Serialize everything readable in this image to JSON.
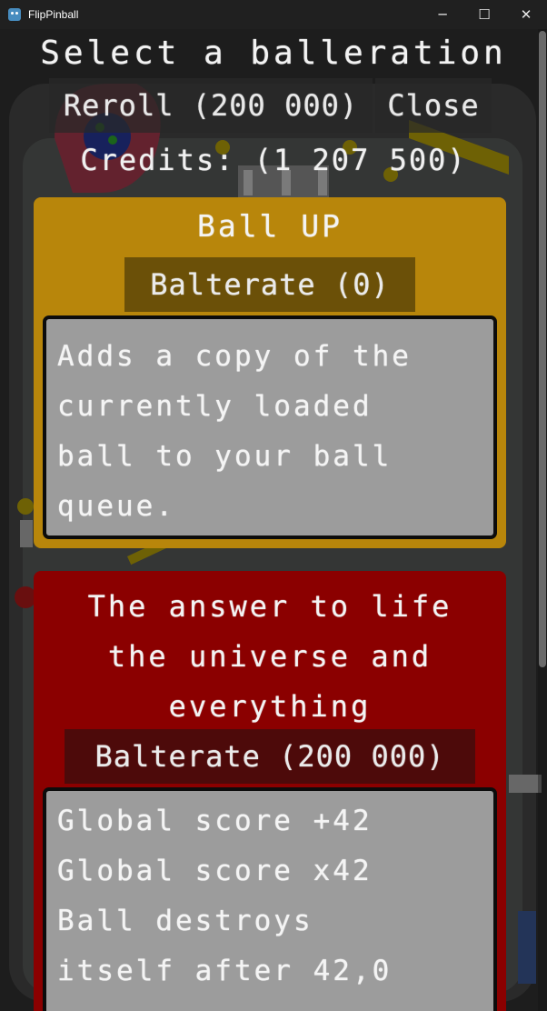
{
  "window": {
    "title": "FlipPinball",
    "controls": {
      "minimize": "─",
      "maximize": "☐",
      "close": "✕"
    }
  },
  "header": {
    "title": "Select a balleration",
    "reroll_label": "Reroll (200 000)",
    "close_label": "Close",
    "credits_label": "Credits: (1 207 500)"
  },
  "cards": [
    {
      "title": "Ball UP",
      "button_label": "Balterate (0)",
      "description": "Adds a copy of the\ncurrently loaded\nball to your ball\nqueue.",
      "color": "#b8860b"
    },
    {
      "title": "The answer to life\nthe universe and\neverything",
      "button_label": "Balterate (200 000)",
      "description": "Global score +42\nGlobal score x42\nBall destroys\nitself after 42,0",
      "color": "#8b0000"
    }
  ],
  "colors": {
    "gold_card": "#b8860b",
    "red_card": "#8b0000",
    "description_box": "#9c9c9c"
  }
}
